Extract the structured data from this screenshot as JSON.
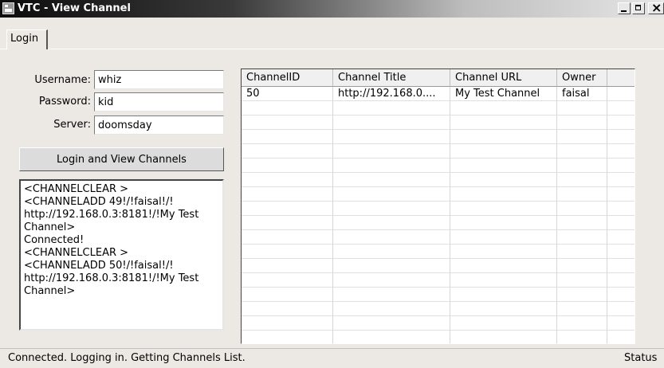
{
  "window": {
    "title": "VTC - View Channel"
  },
  "tabs": [
    {
      "label": "Login"
    }
  ],
  "login": {
    "username_label": "Username:",
    "username_value": "whiz",
    "password_label": "Password:",
    "password_value": "kid",
    "server_label": "Server:",
    "server_value": "doomsday",
    "button_label": "Login and View Channels"
  },
  "log": {
    "lines": [
      "<CHANNELCLEAR >",
      "<CHANNELADD 49!/!faisal!/!",
      "http://192.168.0.3:8181!/!My Test",
      "Channel>",
      "Connected!",
      "<CHANNELCLEAR >",
      "<CHANNELADD 50!/!faisal!/!",
      "http://192.168.0.3:8181!/!My Test",
      "Channel>"
    ]
  },
  "grid": {
    "columns": [
      "ChannelID",
      "Channel Title",
      "Channel URL",
      "Owner"
    ],
    "rows": [
      [
        "50",
        "http://192.168.0....",
        "My Test Channel",
        "faisal"
      ]
    ]
  },
  "status": {
    "text": "Connected. Logging in. Getting Channels List.",
    "label": "Status"
  },
  "colors": {
    "title_bar_dark": "#0c0c0c",
    "title_bar_light": "#e6e6e6",
    "window_bg": "#ece9e4",
    "field_bg": "#ffffff"
  },
  "icons": [
    "app-icon",
    "minimize-icon",
    "maximize-icon",
    "close-icon"
  ]
}
